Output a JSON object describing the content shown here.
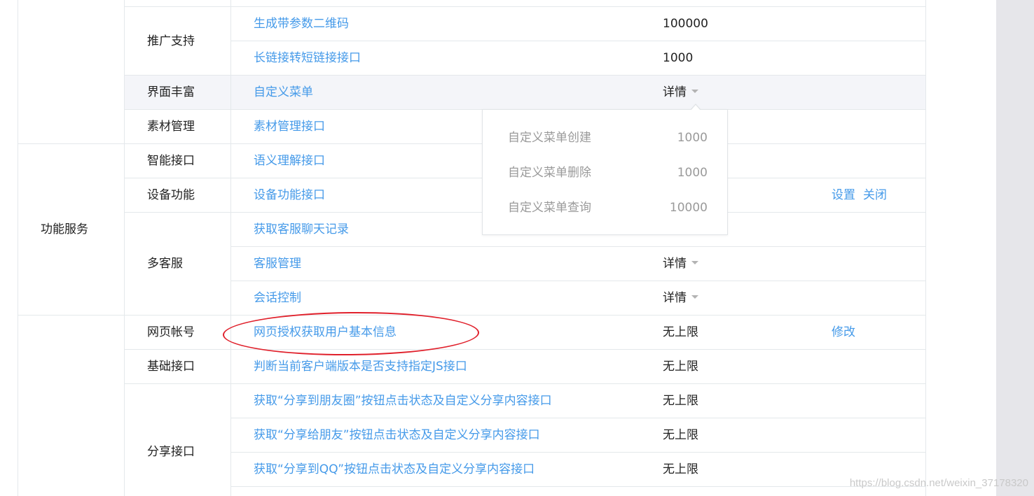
{
  "table": {
    "top_group_label": "",
    "group_label": "功能服务",
    "rows": [
      {
        "category": "推广支持",
        "name": "生成带参数二维码",
        "value": "100000",
        "action": ""
      },
      {
        "category": "",
        "name": "长链接转短链接接口",
        "value": "1000",
        "action": ""
      },
      {
        "category": "界面丰富",
        "name": "自定义菜单",
        "value": "详情",
        "action": ""
      },
      {
        "category": "素材管理",
        "name": "素材管理接口",
        "value": "",
        "action": ""
      },
      {
        "category": "智能接口",
        "name": "语义理解接口",
        "value": "",
        "action": ""
      },
      {
        "category": "设备功能",
        "name": "设备功能接口",
        "value": "",
        "action": "设置"
      },
      {
        "category": "多客服",
        "name": "获取客服聊天记录",
        "value": "",
        "action": ""
      },
      {
        "category": "",
        "name": "客服管理",
        "value": "详情",
        "action": ""
      },
      {
        "category": "",
        "name": "会话控制",
        "value": "详情",
        "action": ""
      },
      {
        "category": "网页帐号",
        "name": "网页授权获取用户基本信息",
        "value": "无上限",
        "action": "修改"
      },
      {
        "category": "基础接口",
        "name": "判断当前客户端版本是否支持指定JS接口",
        "value": "无上限",
        "action": ""
      },
      {
        "category": "分享接口",
        "name": "获取“分享到朋友圈”按钮点击状态及自定义分享内容接口",
        "value": "无上限",
        "action": ""
      },
      {
        "category": "",
        "name": "获取“分享给朋友”按钮点击状态及自定义分享内容接口",
        "value": "无上限",
        "action": ""
      },
      {
        "category": "",
        "name": "获取“分享到QQ”按钮点击状态及自定义分享内容接口",
        "value": "无上限",
        "action": ""
      }
    ],
    "device_close_label": "关闭"
  },
  "popover": {
    "items": [
      {
        "name": "自定义菜单创建",
        "value": "1000"
      },
      {
        "name": "自定义菜单删除",
        "value": "1000"
      },
      {
        "name": "自定义菜单查询",
        "value": "10000"
      }
    ]
  },
  "watermark": "https://blog.csdn.net/weixin_37178320",
  "colors": {
    "link": "#459ae9",
    "highlight_circle": "#e0202b",
    "row_hover": "#f4f5f9"
  }
}
